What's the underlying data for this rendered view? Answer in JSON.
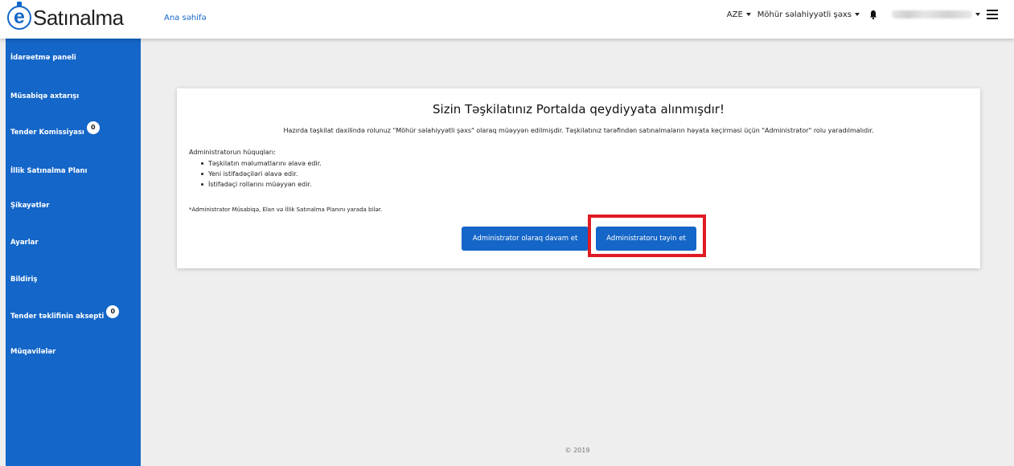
{
  "header": {
    "logo_text": "Satınalma",
    "home_link": "Ana səhifə",
    "language": "AZE",
    "role": "Möhür səlahiyyətli şəxs"
  },
  "sidebar": {
    "items": [
      {
        "label": "İdarəetmə paneli"
      },
      {
        "label": "Müsabiqə axtarışı"
      },
      {
        "label": "Tender Komissiyası",
        "badge": "0"
      },
      {
        "label": "İllik Satınalma Planı"
      },
      {
        "label": "Şikayətlər"
      },
      {
        "label": "Ayarlar"
      },
      {
        "label": "Bildiriş"
      },
      {
        "label": "Tender təklifinin aksepti",
        "badge": "0"
      },
      {
        "label": "Müqavilələr"
      }
    ]
  },
  "main": {
    "title": "Sizin Təşkilatınız Portalda qeydiyyata alınmışdır!",
    "subtitle": "Hazırda təşkilat daxilində rolunuz \"Möhür səlahiyyətli şəxs\" olaraq müəyyən edilmişdir. Təşkilatınız tərəfindən satınalmaların həyata keçirməsi üçün \"Administrator\" rolu yaradılmalıdır.",
    "rights_heading": "Administratorun hüquqları:",
    "rights": [
      "Təşkilatın məlumatlarını əlavə edir.",
      "Yeni istifadəçiləri əlavə edir.",
      "İstifadəçi rollarını müəyyən edir."
    ],
    "note": "*Administrator Müsabiqə, Elan və İllik Satınalma Planını yarada bilər.",
    "btn_continue": "Administrator olaraq davam et",
    "btn_assign": "Administratoru təyin et"
  },
  "footer": {
    "copyright": "© 2019"
  },
  "colors": {
    "brand": "#1466c8",
    "highlight": "#e01b23"
  }
}
